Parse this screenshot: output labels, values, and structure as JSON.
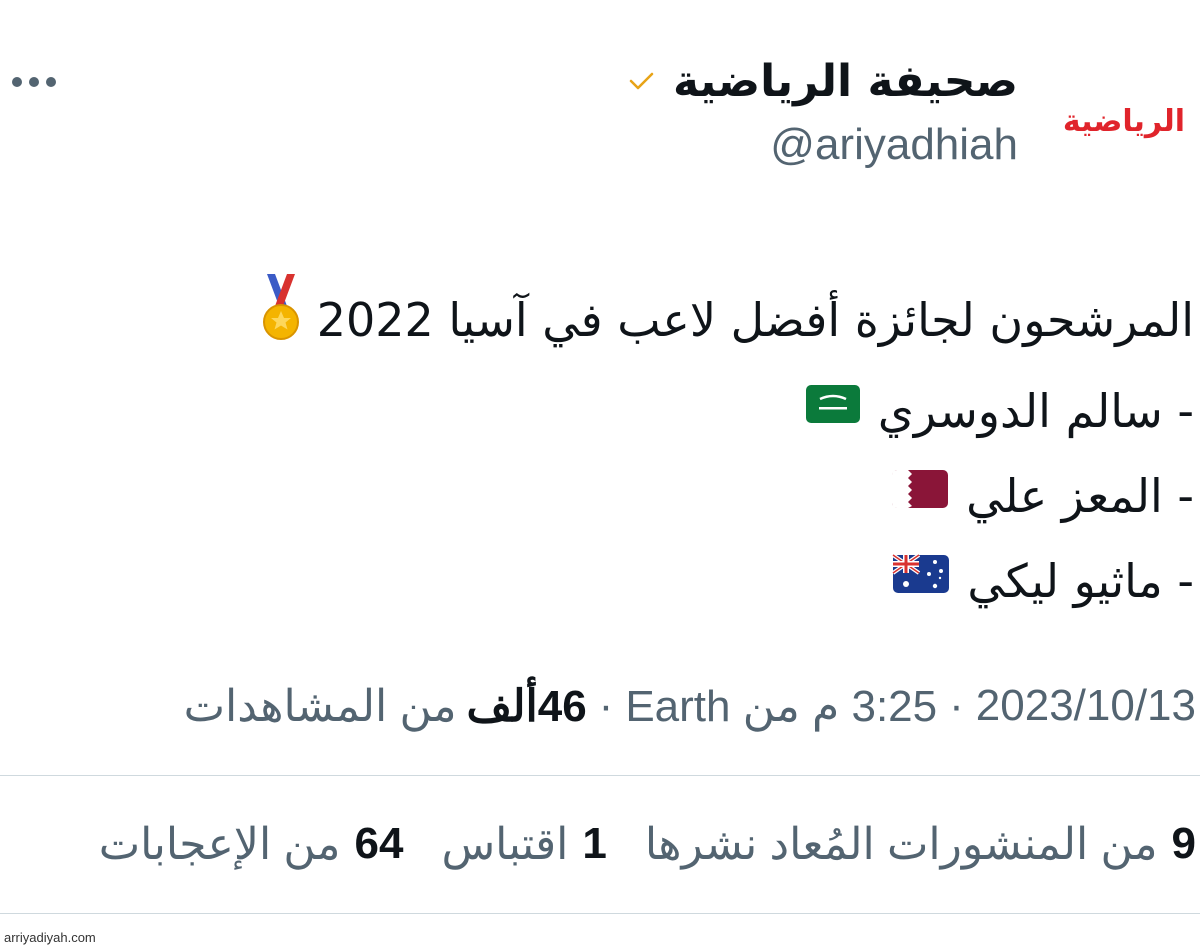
{
  "header": {
    "display_name": "صحيفة الرياضية",
    "handle": "@ariyadhiah",
    "avatar_text": "الرياضية",
    "verified_color": "#e8a317",
    "more_icon": "more-horizontal-icon"
  },
  "tweet": {
    "lines": [
      {
        "text": "المرشحون لجائزة أفضل لاعب في آسيا 2022",
        "emoji": "medal-icon"
      },
      {
        "text": "- سالم الدوسري",
        "emoji": "flag-saudi-arabia-icon"
      },
      {
        "text": "- المعز علي",
        "emoji": "flag-qatar-icon"
      },
      {
        "text": "- ماثيو ليكي",
        "emoji": "flag-australia-icon"
      }
    ]
  },
  "meta": {
    "date": "2023/10/13",
    "time": "3:25 م من Earth",
    "views_count": "46ألف",
    "views_label": "من المشاهدات"
  },
  "stats": {
    "reposts_count": "9",
    "reposts_label": "من المنشورات المُعاد نشرها",
    "quotes_count": "1",
    "quotes_label": "اقتباس",
    "likes_count": "64",
    "likes_label": "من الإعجابات"
  },
  "watermark": "arriyadiyah.com",
  "colors": {
    "text": "#0f1419",
    "secondary": "#536471",
    "divider": "#cfd9de",
    "brand_red": "#e0242b"
  }
}
